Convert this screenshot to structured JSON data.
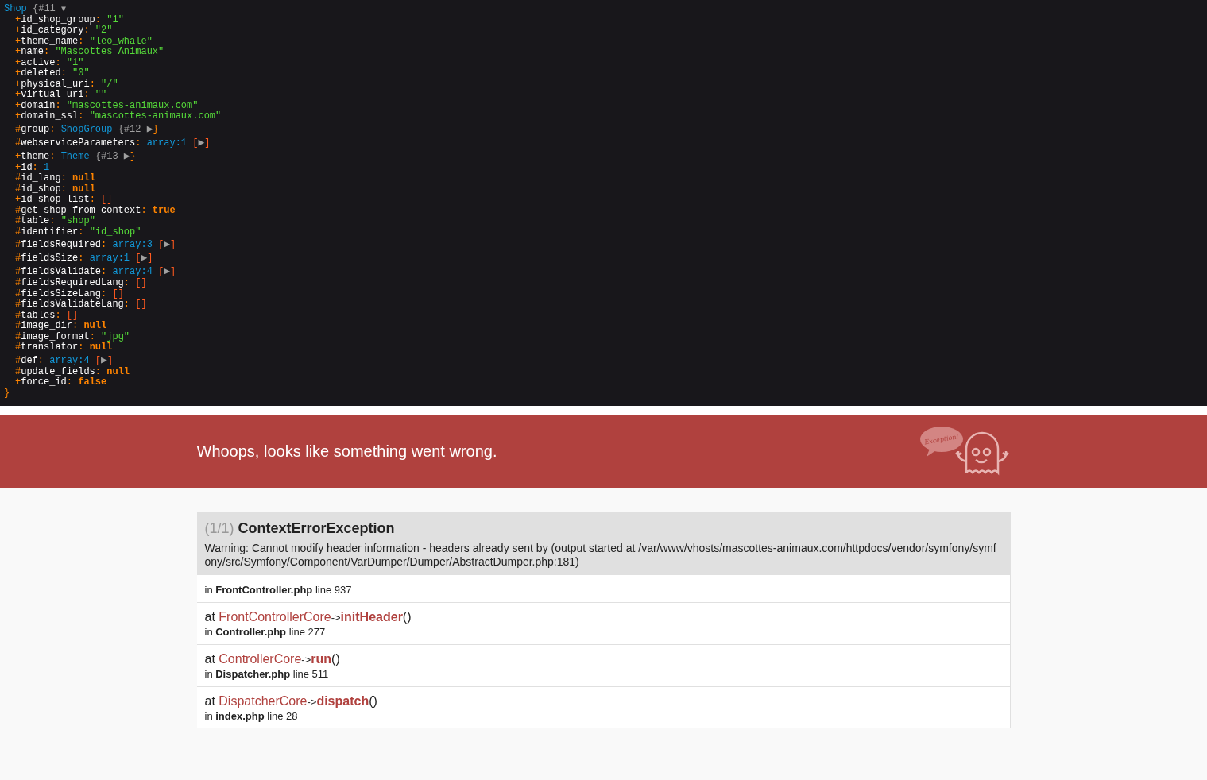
{
  "dump": {
    "class": "Shop",
    "ref": "{#11",
    "toggle": "▼",
    "close": "}",
    "lines": [
      {
        "prefix": "+",
        "key": "id_shop_group:",
        "kind": "string",
        "value": "\"1\""
      },
      {
        "prefix": "+",
        "key": "id_category:",
        "kind": "string",
        "value": "\"2\""
      },
      {
        "prefix": "+",
        "key": "theme_name:",
        "kind": "string",
        "value": "\"leo_whale\""
      },
      {
        "prefix": "+",
        "key": "name:",
        "kind": "string",
        "value": "\"Mascottes Animaux\""
      },
      {
        "prefix": "+",
        "key": "active:",
        "kind": "string",
        "value": "\"1\""
      },
      {
        "prefix": "+",
        "key": "deleted:",
        "kind": "string",
        "value": "\"0\""
      },
      {
        "prefix": "+",
        "key": "physical_uri:",
        "kind": "string",
        "value": "\"/\""
      },
      {
        "prefix": "+",
        "key": "virtual_uri:",
        "kind": "string",
        "value": "\"\""
      },
      {
        "prefix": "+",
        "key": "domain:",
        "kind": "string",
        "value": "\"mascottes-animaux.com\""
      },
      {
        "prefix": "+",
        "key": "domain_ssl:",
        "kind": "string",
        "value": "\"mascottes-animaux.com\""
      },
      {
        "prefix": "#",
        "key": "group:",
        "kind": "object",
        "value": "ShopGroup",
        "ref": "{#12",
        "toggle": "▶",
        "close": "}"
      },
      {
        "prefix": "#",
        "key": "webserviceParameters:",
        "kind": "array",
        "value": "array:1",
        "open": "[",
        "toggle": "▶",
        "close": "]"
      },
      {
        "prefix": "+",
        "key": "theme:",
        "kind": "object",
        "value": "Theme",
        "ref": "{#13",
        "toggle": "▶",
        "close": "}"
      },
      {
        "prefix": "+",
        "key": "id:",
        "kind": "number",
        "value": "1"
      },
      {
        "prefix": "#",
        "key": "id_lang:",
        "kind": "constant",
        "value": "null"
      },
      {
        "prefix": "#",
        "key": "id_shop:",
        "kind": "constant",
        "value": "null"
      },
      {
        "prefix": "+",
        "key": "id_shop_list:",
        "kind": "empty",
        "value": "[]"
      },
      {
        "prefix": "#",
        "key": "get_shop_from_context:",
        "kind": "constant",
        "value": "true"
      },
      {
        "prefix": "#",
        "key": "table:",
        "kind": "string",
        "value": "\"shop\""
      },
      {
        "prefix": "#",
        "key": "identifier:",
        "kind": "string",
        "value": "\"id_shop\""
      },
      {
        "prefix": "#",
        "key": "fieldsRequired:",
        "kind": "array",
        "value": "array:3",
        "open": "[",
        "toggle": "▶",
        "close": "]"
      },
      {
        "prefix": "#",
        "key": "fieldsSize:",
        "kind": "array",
        "value": "array:1",
        "open": "[",
        "toggle": "▶",
        "close": "]"
      },
      {
        "prefix": "#",
        "key": "fieldsValidate:",
        "kind": "array",
        "value": "array:4",
        "open": "[",
        "toggle": "▶",
        "close": "]"
      },
      {
        "prefix": "#",
        "key": "fieldsRequiredLang:",
        "kind": "empty",
        "value": "[]"
      },
      {
        "prefix": "#",
        "key": "fieldsSizeLang:",
        "kind": "empty",
        "value": "[]"
      },
      {
        "prefix": "#",
        "key": "fieldsValidateLang:",
        "kind": "empty",
        "value": "[]"
      },
      {
        "prefix": "#",
        "key": "tables:",
        "kind": "empty",
        "value": "[]"
      },
      {
        "prefix": "#",
        "key": "image_dir:",
        "kind": "constant",
        "value": "null"
      },
      {
        "prefix": "#",
        "key": "image_format:",
        "kind": "string",
        "value": "\"jpg\""
      },
      {
        "prefix": "#",
        "key": "translator:",
        "kind": "constant",
        "value": "null"
      },
      {
        "prefix": "#",
        "key": "def:",
        "kind": "array",
        "value": "array:4",
        "open": "[",
        "toggle": "▶",
        "close": "]"
      },
      {
        "prefix": "#",
        "key": "update_fields:",
        "kind": "constant",
        "value": "null"
      },
      {
        "prefix": "+",
        "key": "force_id:",
        "kind": "constant",
        "value": "false"
      }
    ]
  },
  "error_header": {
    "title": "Whoops, looks like something went wrong.",
    "mascot_bubble": "Exception!"
  },
  "exception": {
    "count": "(1/1)",
    "name": "ContextErrorException",
    "message": "Warning: Cannot modify header information - headers already sent by (output started at /var/www/vhosts/mascottes-animaux.com/httpdocs/vendor/symfony/symfony/src/Symfony/Component/VarDumper/Dumper/AbstractDumper.php:181)",
    "location": {
      "prefix": "in",
      "file": "FrontController.php",
      "line": "line 937"
    },
    "trace": [
      {
        "at": "at",
        "class": "FrontControllerCore",
        "arrow": "->",
        "method": "initHeader",
        "call": "()",
        "prefix": "in",
        "file": "Controller.php",
        "line": "line 277"
      },
      {
        "at": "at",
        "class": "ControllerCore",
        "arrow": "->",
        "method": "run",
        "call": "()",
        "prefix": "in",
        "file": "Dispatcher.php",
        "line": "line 511"
      },
      {
        "at": "at",
        "class": "DispatcherCore",
        "arrow": "->",
        "method": "dispatch",
        "call": "()",
        "prefix": "in",
        "file": "index.php",
        "line": "line 28"
      }
    ]
  }
}
